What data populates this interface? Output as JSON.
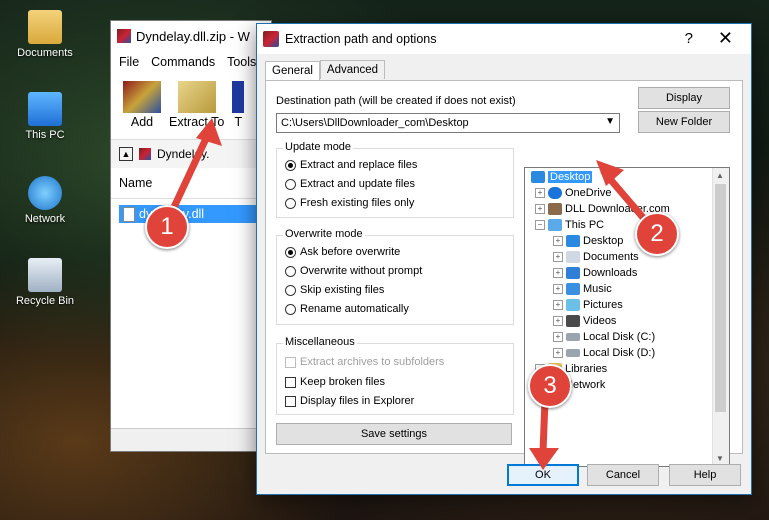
{
  "desktop": {
    "icons": [
      {
        "label": "Documents",
        "icon": "documents-folder-icon"
      },
      {
        "label": "This PC",
        "icon": "this-pc-icon"
      },
      {
        "label": "Network",
        "icon": "network-icon"
      },
      {
        "label": "Recycle Bin",
        "icon": "recycle-bin-icon"
      }
    ]
  },
  "winrar": {
    "title": "Dyndelay.dll.zip - W",
    "menu": [
      "File",
      "Commands",
      "Tools"
    ],
    "tools": [
      {
        "label": "Add"
      },
      {
        "label": "Extract To"
      },
      {
        "label": "T"
      }
    ],
    "address": "Dyndelay.",
    "column_name": "Name",
    "file_row": "dyndelay.dll"
  },
  "dialog": {
    "title": "Extraction path and options",
    "help_glyph": "?",
    "close_glyph": "✕",
    "tabs": [
      "General",
      "Advanced"
    ],
    "destination_label": "Destination path (will be created if does not exist)",
    "destination_value": "C:\\Users\\DllDownloader_com\\Desktop",
    "display_button": "Display",
    "new_folder_button": "New Folder",
    "update_mode": {
      "title": "Update mode",
      "options": [
        "Extract and replace files",
        "Extract and update files",
        "Fresh existing files only"
      ],
      "selected": 0
    },
    "overwrite_mode": {
      "title": "Overwrite mode",
      "options": [
        "Ask before overwrite",
        "Overwrite without prompt",
        "Skip existing files",
        "Rename automatically"
      ],
      "selected": 0
    },
    "miscellaneous": {
      "title": "Miscellaneous",
      "options": [
        "Extract archives to subfolders",
        "Keep broken files",
        "Display files in Explorer"
      ]
    },
    "save_settings_button": "Save settings",
    "tree": [
      "Desktop",
      "OneDrive",
      "DLL Downloader.com",
      "This PC",
      "Desktop",
      "Documents",
      "Downloads",
      "Music",
      "Pictures",
      "Videos",
      "Local Disk (C:)",
      "Local Disk (D:)",
      "Libraries",
      "Network"
    ],
    "ok_button": "OK",
    "cancel_button": "Cancel",
    "help_button": "Help"
  },
  "annotations": [
    "1",
    "2",
    "3"
  ],
  "colors": {
    "accent": "#3399ff",
    "badge": "#e0433a",
    "arrow": "#e0433a"
  }
}
